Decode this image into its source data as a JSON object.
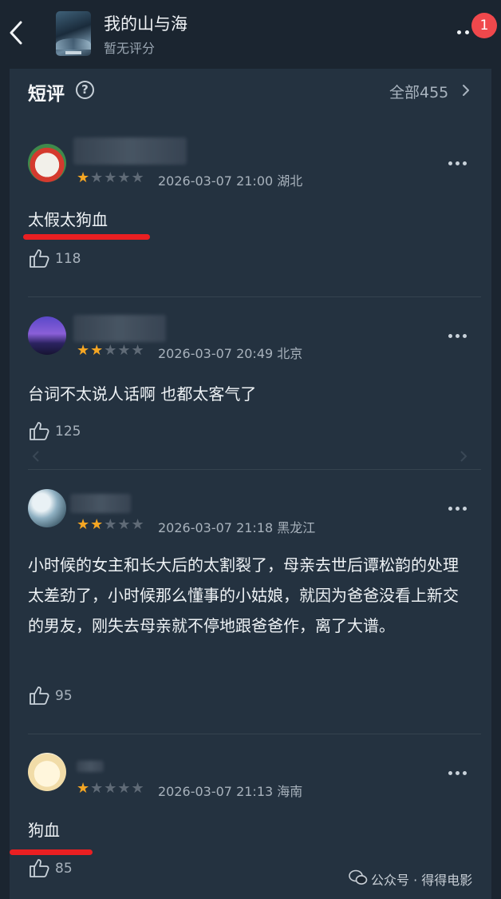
{
  "header": {
    "title": "我的山与海",
    "subtitle": "暂无评分",
    "badge_count": "1"
  },
  "section": {
    "title": "短评",
    "all_link": "全部455"
  },
  "comments": [
    {
      "rating": 1,
      "date": "2026-03-07 21:00",
      "location": "湖北",
      "text": "太假太狗血",
      "likes": "118",
      "underlined": true
    },
    {
      "rating": 2,
      "date": "2026-03-07 20:49",
      "location": "北京",
      "text": "台词不太说人话啊 也都太客气了",
      "likes": "125",
      "underlined": false
    },
    {
      "rating": 2,
      "date": "2026-03-07 21:18",
      "location": "黑龙江",
      "text": "小时候的女主和长大后的太割裂了，母亲去世后谭松韵的处理太差劲了，小时候那么懂事的小姑娘，就因为爸爸没看上新交的男友，刚失去母亲就不停地跟爸爸作，离了大谱。",
      "likes": "95",
      "underlined": false
    },
    {
      "rating": 1,
      "date": "2026-03-07 21:13",
      "location": "海南",
      "text": "狗血",
      "likes": "85",
      "underlined": true
    }
  ],
  "watermark": "公众号 · 得得电影",
  "colors": {
    "star_on": "#f5a623",
    "star_off": "#5f6a76",
    "underline": "#ea1f22",
    "badge": "#f0484c"
  }
}
